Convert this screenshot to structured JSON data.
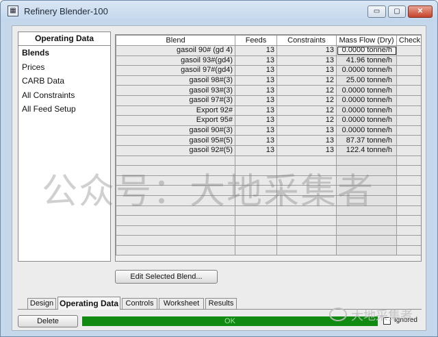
{
  "window": {
    "title": "Refinery Blender-100",
    "app_icon": "blender-app-icon",
    "minimize_label": "▭",
    "maximize_label": "▢",
    "close_label": "✕"
  },
  "sidebar": {
    "heading": "Operating Data",
    "items": [
      {
        "label": "Blends",
        "active": true
      },
      {
        "label": "Prices"
      },
      {
        "label": "CARB Data"
      },
      {
        "label": "All Constraints"
      },
      {
        "label": "All Feed Setup"
      }
    ]
  },
  "grid": {
    "columns": [
      "Blend",
      "Feeds",
      "Constraints",
      "Mass Flow (Dry)",
      "Check"
    ],
    "rows": [
      {
        "blend": "gasoil 90# (gd 4)",
        "feeds": "13",
        "constraints": "13",
        "mass_flow": "0.0000 tonne/h",
        "check": ""
      },
      {
        "blend": "gasoil 93#(gd4)",
        "feeds": "13",
        "constraints": "13",
        "mass_flow": "41.96 tonne/h",
        "check": ""
      },
      {
        "blend": "gasoil 97#(gd4)",
        "feeds": "13",
        "constraints": "13",
        "mass_flow": "0.0000 tonne/h",
        "check": ""
      },
      {
        "blend": "gasoil 98#(3)",
        "feeds": "13",
        "constraints": "12",
        "mass_flow": "25.00 tonne/h",
        "check": ""
      },
      {
        "blend": "gasoil 93#(3)",
        "feeds": "13",
        "constraints": "12",
        "mass_flow": "0.0000 tonne/h",
        "check": ""
      },
      {
        "blend": "gasoil 97#(3)",
        "feeds": "13",
        "constraints": "12",
        "mass_flow": "0.0000 tonne/h",
        "check": ""
      },
      {
        "blend": "Export 92#",
        "feeds": "13",
        "constraints": "12",
        "mass_flow": "0.0000 tonne/h",
        "check": ""
      },
      {
        "blend": "Export 95#",
        "feeds": "13",
        "constraints": "12",
        "mass_flow": "0.0000 tonne/h",
        "check": ""
      },
      {
        "blend": "gasoil 90#(3)",
        "feeds": "13",
        "constraints": "13",
        "mass_flow": "0.0000 tonne/h",
        "check": ""
      },
      {
        "blend": "gasoil 95#(5)",
        "feeds": "13",
        "constraints": "13",
        "mass_flow": "87.37 tonne/h",
        "check": ""
      },
      {
        "blend": "gasoil 92#(5)",
        "feeds": "13",
        "constraints": "13",
        "mass_flow": "122.4 tonne/h",
        "check": ""
      }
    ],
    "empty_rows": 10
  },
  "buttons": {
    "edit_selected_blend": "Edit Selected Blend...",
    "delete": "Delete"
  },
  "tabs": [
    {
      "label": "Design"
    },
    {
      "label": "Operating Data",
      "active": true
    },
    {
      "label": "Controls"
    },
    {
      "label": "Worksheet"
    },
    {
      "label": "Results"
    }
  ],
  "status": {
    "text": "OK",
    "color": "#108a10"
  },
  "ignored": {
    "label": "Ignored",
    "checked": false
  },
  "watermark": {
    "text": "公众号：大地采集者",
    "small_text": "大地采集者",
    "icon": "wechat-icon"
  }
}
